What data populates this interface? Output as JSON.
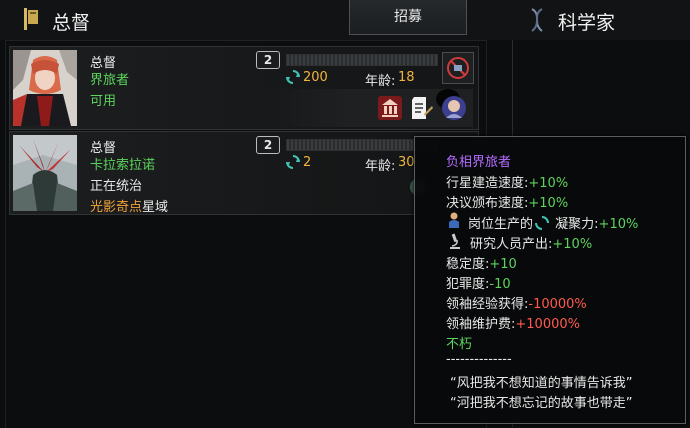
{
  "header": {
    "title": "总督",
    "tab_recruit": "招募",
    "right_title": "科学家"
  },
  "governors": [
    {
      "role": "总督",
      "name": "界旅者",
      "status": "可用",
      "level": "2",
      "xp_fraction": 0.0,
      "cost": "200",
      "age_label": "年龄:",
      "age": "18",
      "traits": [
        "building-trait-icon",
        "document-trait-icon",
        "dark-sphere-trait-icon",
        "portrait-trait-icon"
      ]
    },
    {
      "role": "总督",
      "name": "卡拉索拉诺",
      "status": "正在统治",
      "location_highlight": "光影奇点",
      "location_suffix": "星域",
      "level": "2",
      "xp_fraction": 0.0,
      "cost": "2",
      "age_label": "年龄:",
      "age": "30"
    }
  ],
  "tooltip": {
    "title": "负相界旅者",
    "lines": [
      {
        "label": "行星建造速度:",
        "value": "+10%"
      },
      {
        "label": "决议颁布速度:",
        "value": "+10%"
      }
    ],
    "job_line": {
      "prefix": "岗位生产的",
      "suffix": "凝聚力:",
      "value": "+10%"
    },
    "research_line": {
      "label": "研究人员产出:",
      "value": "+10%"
    },
    "stability": {
      "label": "稳定度:",
      "value": "+10"
    },
    "crime": {
      "label": "犯罪度:",
      "value": "-10"
    },
    "xp": {
      "label": "领袖经验获得:",
      "value": "-10000%"
    },
    "upkeep": {
      "label": "领袖维护费:",
      "value": "+10000%"
    },
    "immortal": "不朽",
    "divider": "--------------",
    "quote1": "“风把我不想知道的事情告诉我”",
    "quote2": "“河把我不想忘记的故事也带走”"
  },
  "colors": {
    "green": "#5dd45d",
    "orange": "#f2b43c",
    "purple": "#b46cff",
    "red": "#ff5a4d"
  }
}
